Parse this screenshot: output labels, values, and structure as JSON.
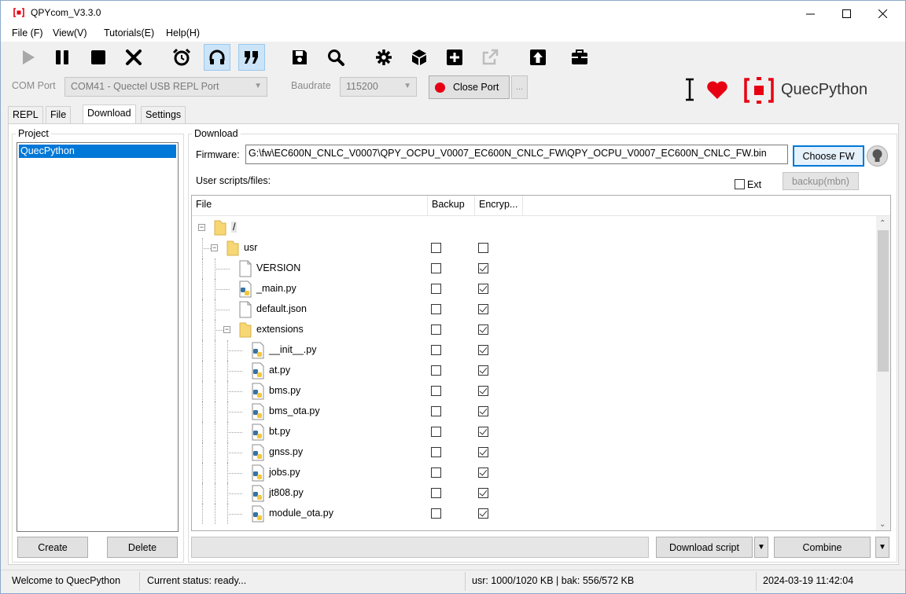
{
  "window": {
    "title": "QPYcom_V3.3.0"
  },
  "menu": [
    "File (F)",
    "View(V)",
    "Tutorials(E)",
    "Help(H)"
  ],
  "toolbar": {
    "icons": [
      "play-icon",
      "pause-icon",
      "stop-icon",
      "close-icon",
      "alarm-icon",
      "headset-icon",
      "quote-icon",
      "save-icon",
      "search-icon",
      "gear-icon",
      "cube-icon",
      "plus-icon",
      "export-icon",
      "upload-icon",
      "toolbox-icon"
    ]
  },
  "port": {
    "com_label": "COM Port",
    "com_value": "COM41 - Quectel USB REPL Port",
    "baud_label": "Baudrate",
    "baud_value": "115200",
    "close_label": "Close Port",
    "more_label": "..."
  },
  "brand": {
    "name": "QuecPython",
    "accent": "#e60012"
  },
  "tabs": [
    "REPL",
    "File",
    "Download",
    "Settings"
  ],
  "project": {
    "title": "Project",
    "items": [
      "QuecPython"
    ],
    "create_label": "Create",
    "delete_label": "Delete"
  },
  "download": {
    "title": "Download",
    "firmware_label": "Firmware:",
    "firmware_path": "G:\\fw\\EC600N_CNLC_V0007\\QPY_OCPU_V0007_EC600N_CNLC_FW\\QPY_OCPU_V0007_EC600N_CNLC_FW.bin",
    "choose_label": "Choose FW",
    "scripts_label": "User scripts/files:",
    "ext_label": "Ext",
    "backup_mbn_label": "backup(mbn)",
    "columns": [
      "File",
      "Backup",
      "Encryp..."
    ],
    "tree": [
      {
        "name": "/",
        "type": "folder",
        "level": 0,
        "expanded": true,
        "backup": null,
        "encrypt": null
      },
      {
        "name": "usr",
        "type": "folder",
        "level": 1,
        "expanded": true,
        "backup": false,
        "encrypt": false
      },
      {
        "name": "VERSION",
        "type": "file",
        "level": 2,
        "backup": false,
        "encrypt": true
      },
      {
        "name": "_main.py",
        "type": "py",
        "level": 2,
        "backup": false,
        "encrypt": true
      },
      {
        "name": "default.json",
        "type": "file",
        "level": 2,
        "backup": false,
        "encrypt": true
      },
      {
        "name": "extensions",
        "type": "folder",
        "level": 2,
        "expanded": true,
        "backup": false,
        "encrypt": true
      },
      {
        "name": "__init__.py",
        "type": "py",
        "level": 3,
        "backup": false,
        "encrypt": true
      },
      {
        "name": "at.py",
        "type": "py",
        "level": 3,
        "backup": false,
        "encrypt": true
      },
      {
        "name": "bms.py",
        "type": "py",
        "level": 3,
        "backup": false,
        "encrypt": true
      },
      {
        "name": "bms_ota.py",
        "type": "py",
        "level": 3,
        "backup": false,
        "encrypt": true
      },
      {
        "name": "bt.py",
        "type": "py",
        "level": 3,
        "backup": false,
        "encrypt": true
      },
      {
        "name": "gnss.py",
        "type": "py",
        "level": 3,
        "backup": false,
        "encrypt": true
      },
      {
        "name": "jobs.py",
        "type": "py",
        "level": 3,
        "backup": false,
        "encrypt": true
      },
      {
        "name": "jt808.py",
        "type": "py",
        "level": 3,
        "backup": false,
        "encrypt": true
      },
      {
        "name": "module_ota.py",
        "type": "py",
        "level": 3,
        "backup": false,
        "encrypt": true
      }
    ],
    "download_script_label": "Download script",
    "combine_label": "Combine"
  },
  "status": {
    "welcome": "Welcome to QuecPython",
    "current": "Current status: ready...",
    "usage": "usr: 1000/1020 KB | bak: 556/572 KB",
    "datetime": "2024-03-19 11:42:04"
  }
}
